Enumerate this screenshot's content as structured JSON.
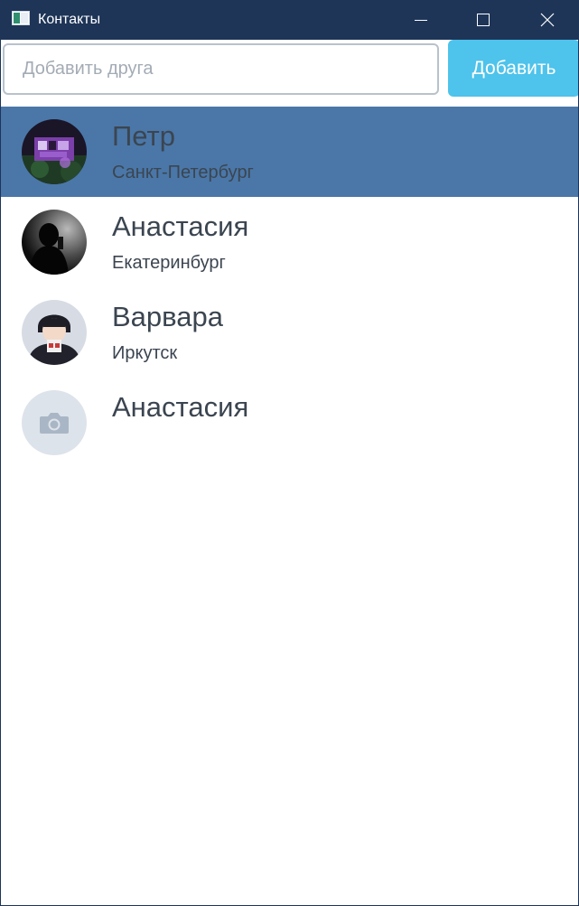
{
  "window": {
    "title": "Контакты"
  },
  "add_friend": {
    "placeholder": "Добавить друга",
    "value": "",
    "button_label": "Добавить"
  },
  "contacts": [
    {
      "name": "Петр",
      "city": "Санкт-Петербург",
      "selected": true,
      "avatar": "photo-purple-night"
    },
    {
      "name": "Анастасия",
      "city": "Екатеринбург",
      "selected": false,
      "avatar": "photo-dark-silhouette"
    },
    {
      "name": "Варвара",
      "city": "Иркутск",
      "selected": false,
      "avatar": "photo-anime-character"
    },
    {
      "name": "Анастасия",
      "city": "",
      "selected": false,
      "avatar": "camera-placeholder-icon"
    }
  ],
  "colors": {
    "titlebar": "#1e3558",
    "selected_row": "#4a77a8",
    "accent_button": "#4ec3eb",
    "placeholder_avatar_bg": "#dde3ea"
  }
}
